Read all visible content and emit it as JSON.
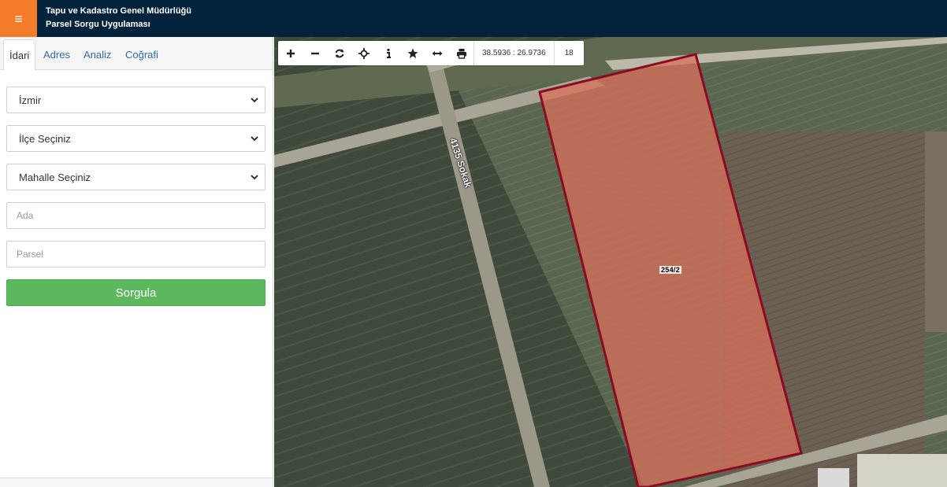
{
  "header": {
    "title_line1": "Tapu ve Kadastro Genel Müdürlüğü",
    "title_line2": "Parsel Sorgu Uygulaması",
    "menu_icon": "hamburger-menu-icon",
    "menu_glyph": "≡",
    "accent_color": "#f47b2a",
    "bar_color": "#03233c"
  },
  "sidebar": {
    "tabs": [
      {
        "label": "İdari",
        "active": true
      },
      {
        "label": "Adres",
        "active": false
      },
      {
        "label": "Analiz",
        "active": false
      },
      {
        "label": "Coğrafi",
        "active": false
      }
    ],
    "form": {
      "il_value": "İzmir",
      "ilce_value": "İlçe Seçiniz",
      "mahalle_value": "Mahalle Seçiniz",
      "ada_placeholder": "Ada",
      "parsel_placeholder": "Parsel",
      "submit_label": "Sorgula",
      "submit_color": "#5cb85c"
    }
  },
  "map": {
    "toolbar": {
      "tools": [
        "zoom-in-icon",
        "zoom-out-icon",
        "refresh-icon",
        "crosshair-icon",
        "info-icon",
        "star-icon",
        "measure-icon",
        "print-icon"
      ],
      "coordinates": "38.5936 : 26.9736",
      "zoom_level": "18"
    },
    "parcel_label": "254/2",
    "street_label": "4135 Sokak",
    "parcel_fill_color": "#d9705a",
    "parcel_stroke_color": "#8b0a24"
  }
}
